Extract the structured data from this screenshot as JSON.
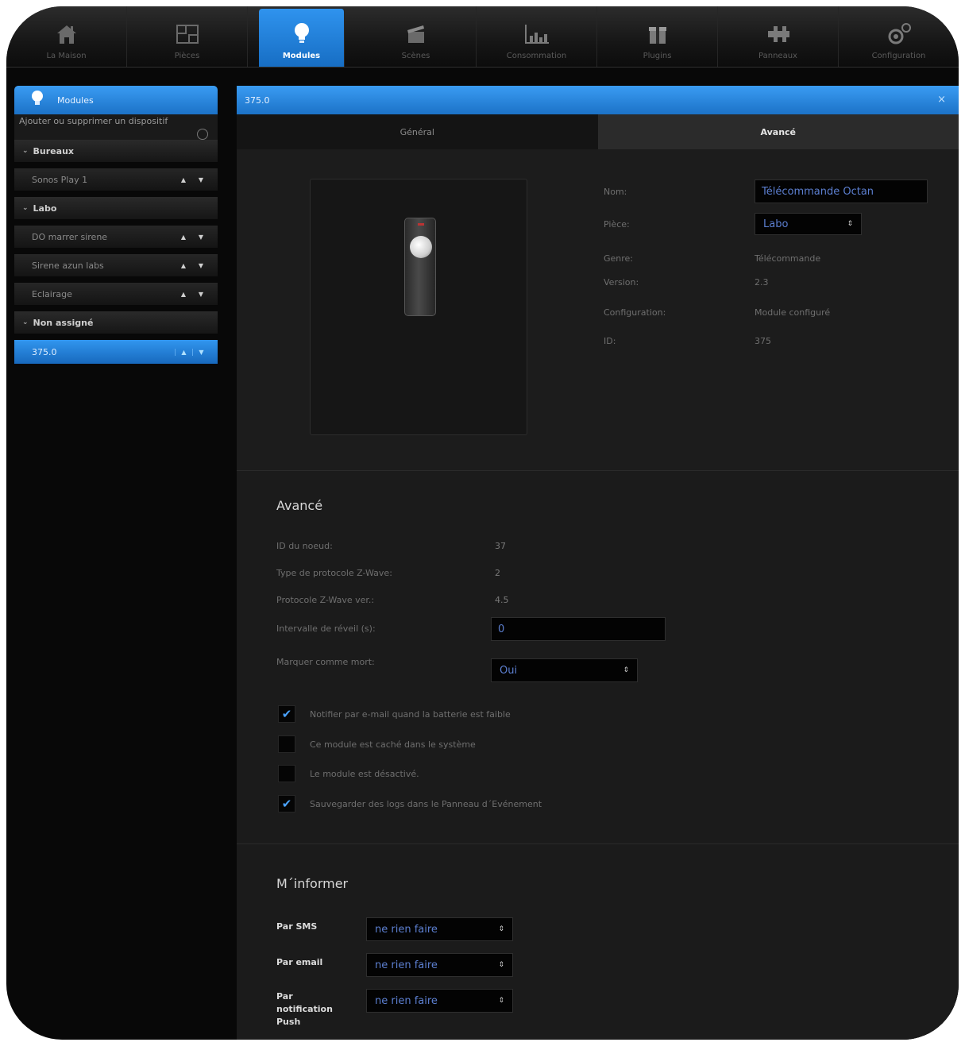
{
  "nav": {
    "items": [
      {
        "label": "La Maison",
        "icon": "house-icon"
      },
      {
        "label": "Pièces",
        "icon": "floorplan-icon"
      },
      {
        "label": "Modules",
        "icon": "bulb-icon",
        "active": true
      },
      {
        "label": "Scènes",
        "icon": "clapper-icon"
      },
      {
        "label": "Consommation",
        "icon": "bar-chart-icon"
      },
      {
        "label": "Plugins",
        "icon": "gift-icon"
      },
      {
        "label": "Panneaux",
        "icon": "puzzle-icon"
      },
      {
        "label": "Configuration",
        "icon": "gears-icon"
      }
    ]
  },
  "sidebar": {
    "title": "Modules",
    "add_text": "Ajouter ou supprimer un dispositif",
    "groups": [
      {
        "name": "Bureaux",
        "items": [
          "Sonos Play 1"
        ]
      },
      {
        "name": "Labo",
        "items": [
          "DO marrer sirene",
          "Sirene azun labs",
          "Eclairage"
        ]
      },
      {
        "name": "Non assigné",
        "items": [
          "375.0"
        ]
      }
    ],
    "arrow_up": "▲",
    "arrow_down": "▼"
  },
  "panel": {
    "title": "375.0",
    "close": "×",
    "tabs": {
      "general": "Général",
      "avance": "Avancé"
    },
    "info": {
      "nom_label": "Nom:",
      "nom_value": "Télécommande Octan",
      "piece_label": "Pièce:",
      "piece_value": "Labo",
      "genre_label": "Genre:",
      "genre_value": "Télécommande",
      "version_label": "Version:",
      "version_value": "2.3",
      "config_label": "Configuration:",
      "config_value": "Module configuré",
      "id_label": "ID:",
      "id_value": "375"
    },
    "advanced": {
      "title": "Avancé",
      "rows": [
        {
          "label": "ID du noeud:",
          "value": "37"
        },
        {
          "label": "Type de protocole Z-Wave:",
          "value": "2"
        },
        {
          "label": "Protocole Z-Wave ver.:",
          "value": "4.5"
        }
      ],
      "interval_label": "Intervalle de réveil (s):",
      "interval_value": "0",
      "dead_label": "Marquer comme mort:",
      "dead_value": "Oui",
      "checks": [
        {
          "label": "Notifier par e-mail quand la batterie est faible",
          "checked": true
        },
        {
          "label": "Ce module est caché dans le système",
          "checked": false
        },
        {
          "label": "Le module est désactivé.",
          "checked": false
        },
        {
          "label": "Sauvegarder des logs dans le Panneau d´Evénement",
          "checked": true
        }
      ]
    },
    "inform": {
      "title": "M´informer",
      "sms_label": "Par SMS",
      "email_label": "Par email",
      "push_label": "Par notification Push",
      "option": "ne rien faire"
    }
  },
  "colors": {
    "accent": "#2a8ae6",
    "background": "#080808",
    "panel": "#1b1b1b",
    "link_text": "#5c7fd0"
  }
}
